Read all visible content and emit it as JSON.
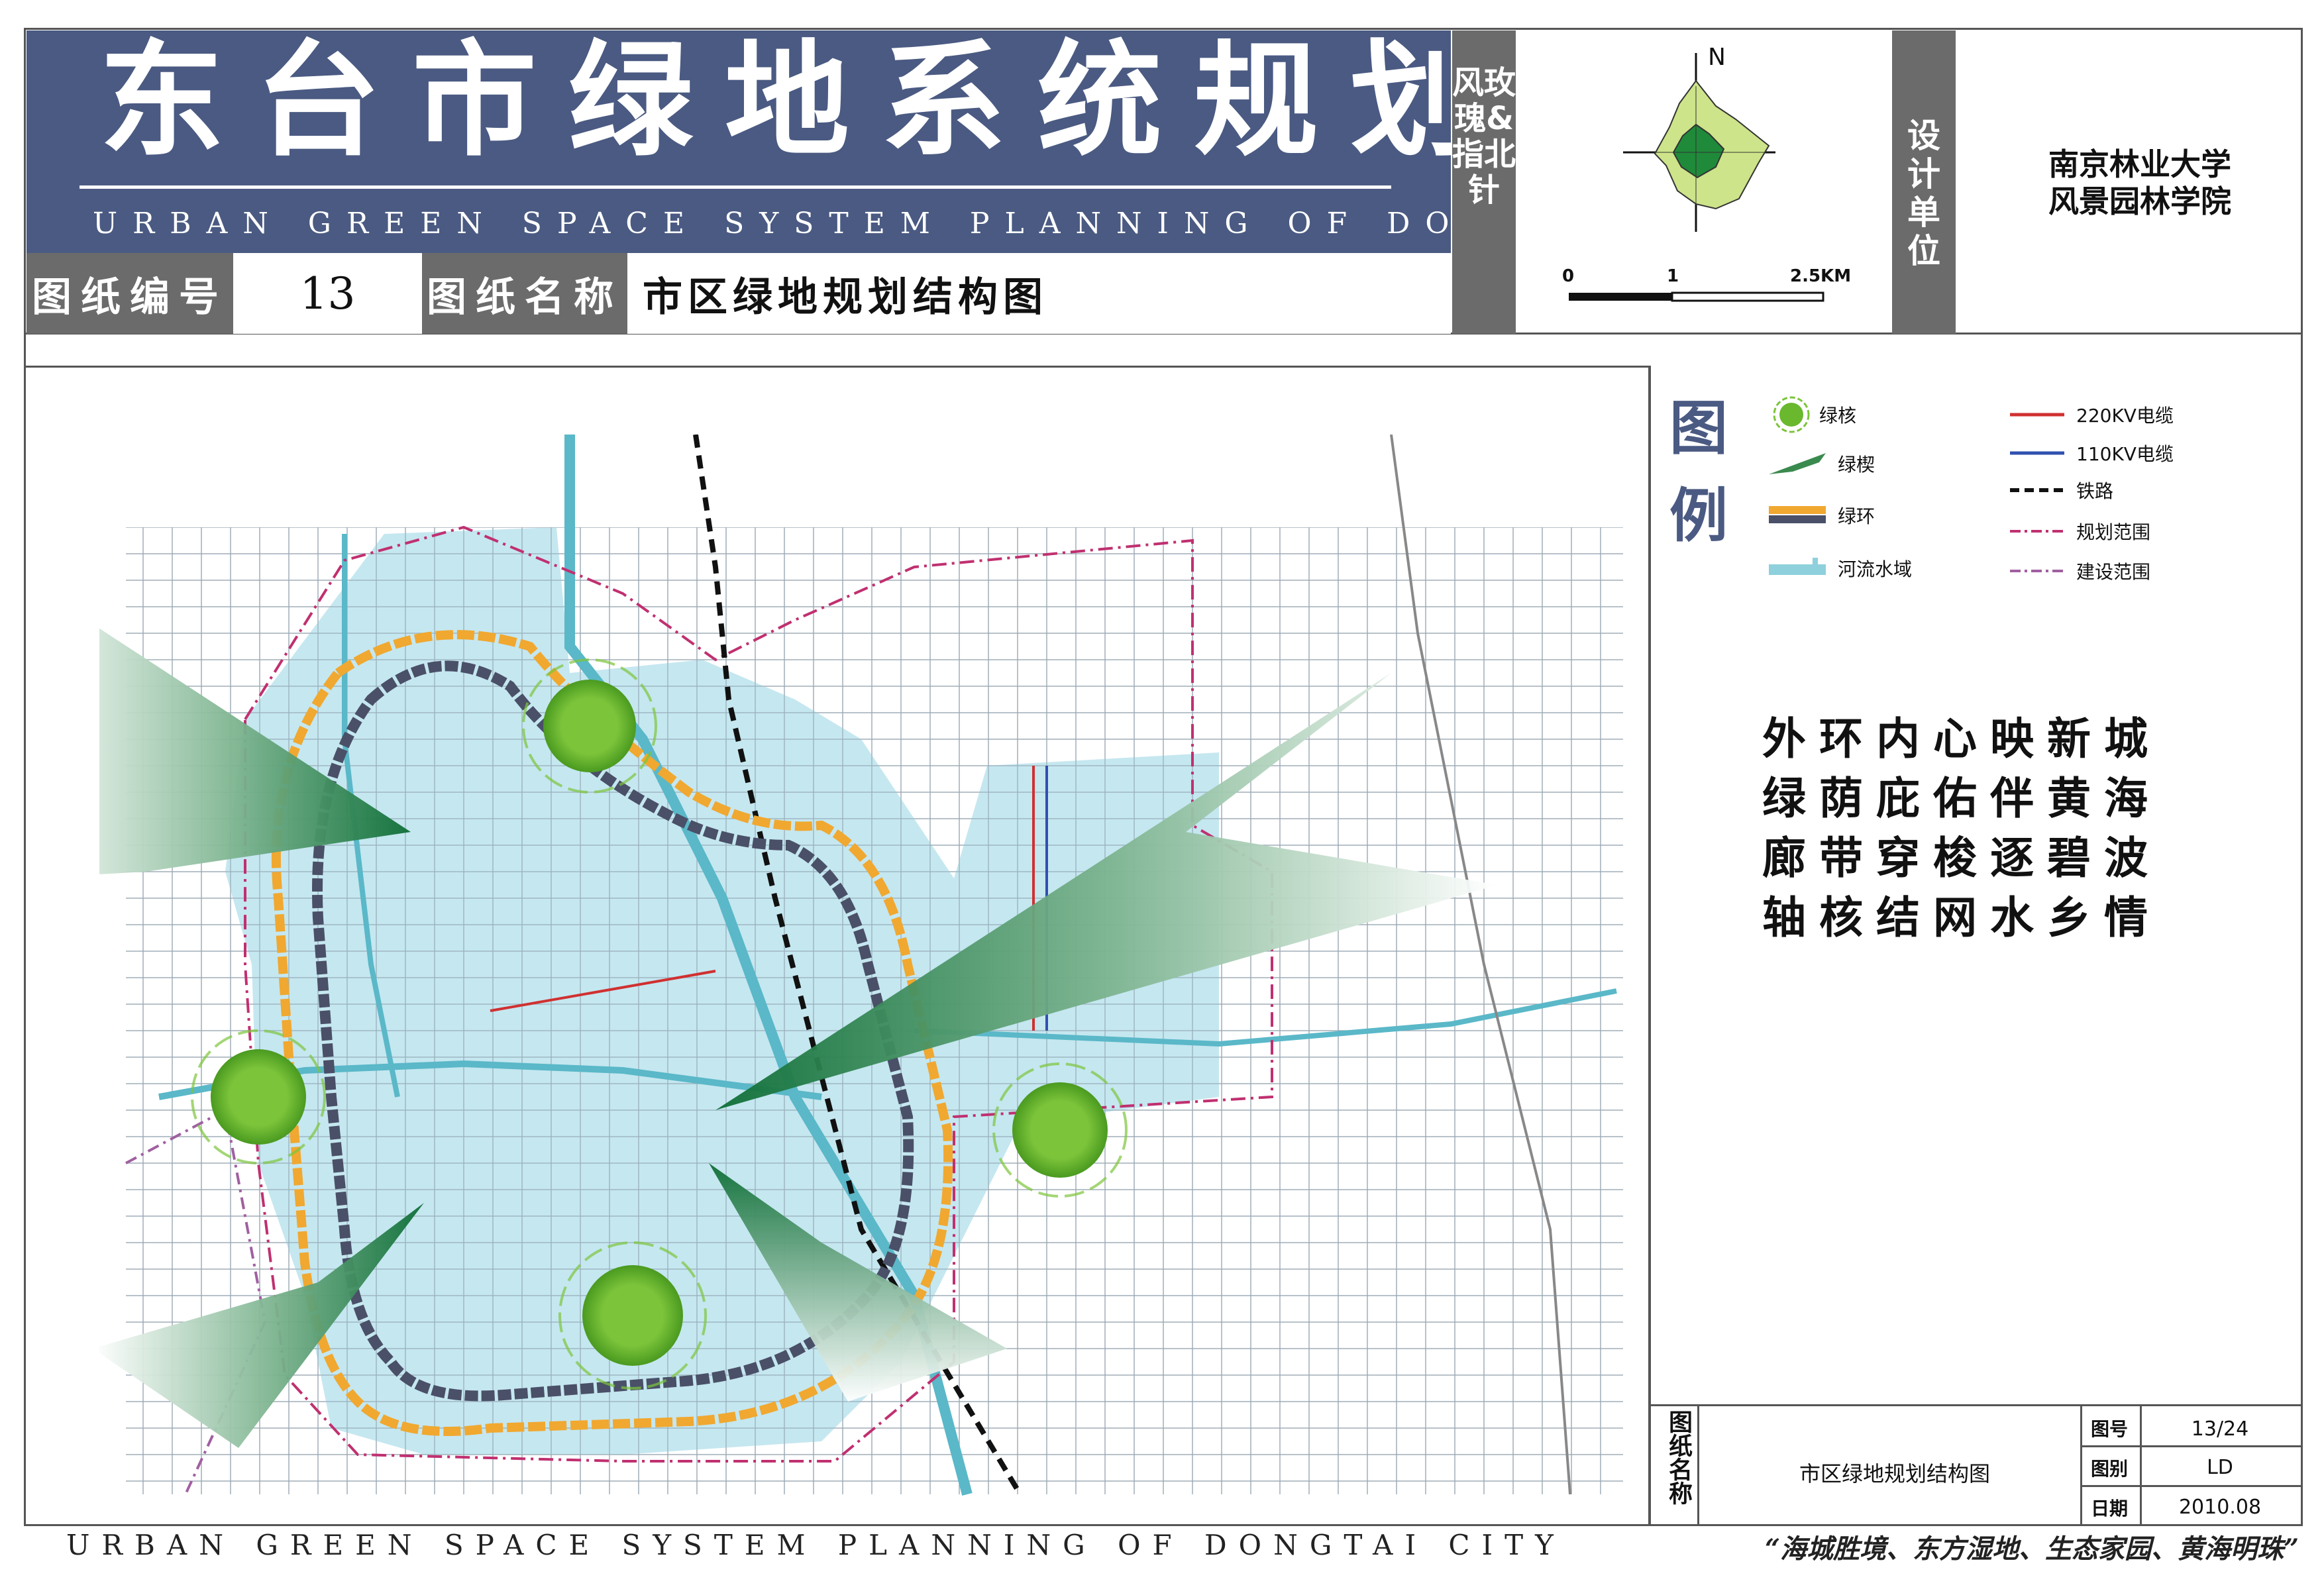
{
  "header": {
    "title": "东台市绿地系统规划",
    "subtitle": "URBAN GREEN SPACE SYSTEM PLANNING OF DONGTAI CITY",
    "drawing_no_label": "图纸编号",
    "drawing_no": "13",
    "drawing_name_label": "图纸名称",
    "drawing_name": "市区绿地规划结构图",
    "compass_label": "风玫瑰&指北针",
    "north_label": "N",
    "scale": [
      "0",
      "1",
      "2.5KM"
    ],
    "design_unit_label": "设计单位",
    "design_unit": [
      "南京林业大学",
      "风景园林学院"
    ]
  },
  "legend": {
    "heading": "图例",
    "items": [
      {
        "label": "绿核",
        "icon": "green-core-icon"
      },
      {
        "label": "绿楔",
        "icon": "green-wedge-icon"
      },
      {
        "label": "绿环",
        "icon": "green-ring-icon"
      },
      {
        "label": "河流水域",
        "icon": "river-icon"
      },
      {
        "label": "220KV电缆",
        "icon": "cable-220kv-icon",
        "color": "#d03030"
      },
      {
        "label": "110KV电缆",
        "icon": "cable-110kv-icon",
        "color": "#3050b0"
      },
      {
        "label": "铁路",
        "icon": "railway-icon"
      },
      {
        "label": "规划范围",
        "icon": "planning-boundary-icon",
        "color": "#c03070"
      },
      {
        "label": "建设范围",
        "icon": "construction-boundary-icon",
        "color": "#a060a0"
      }
    ]
  },
  "slogan": [
    "外环内心映新城",
    "绿荫庇佑伴黄海",
    "廊带穿梭逐碧波",
    "轴核结网水乡情"
  ],
  "title_block": {
    "name_label": "图纸名称",
    "name": "市区绿地规划结构图",
    "rows": [
      {
        "label": "图号",
        "value": "13/24"
      },
      {
        "label": "图别",
        "value": "LD"
      },
      {
        "label": "日期",
        "value": "2010.08"
      }
    ]
  },
  "footer": {
    "left": "URBAN GREEN SPACE SYSTEM PLANNING OF DONGTAI CITY",
    "right": "“海城胜境、东方湿地、生态家园、黄海明珠”"
  },
  "colors": {
    "header_blue": "#4a5a82",
    "water_blue": "#bfe4ee",
    "green_core": "#6ab82e",
    "ring_orange": "#f0a830",
    "ring_dark": "#4a5068"
  }
}
